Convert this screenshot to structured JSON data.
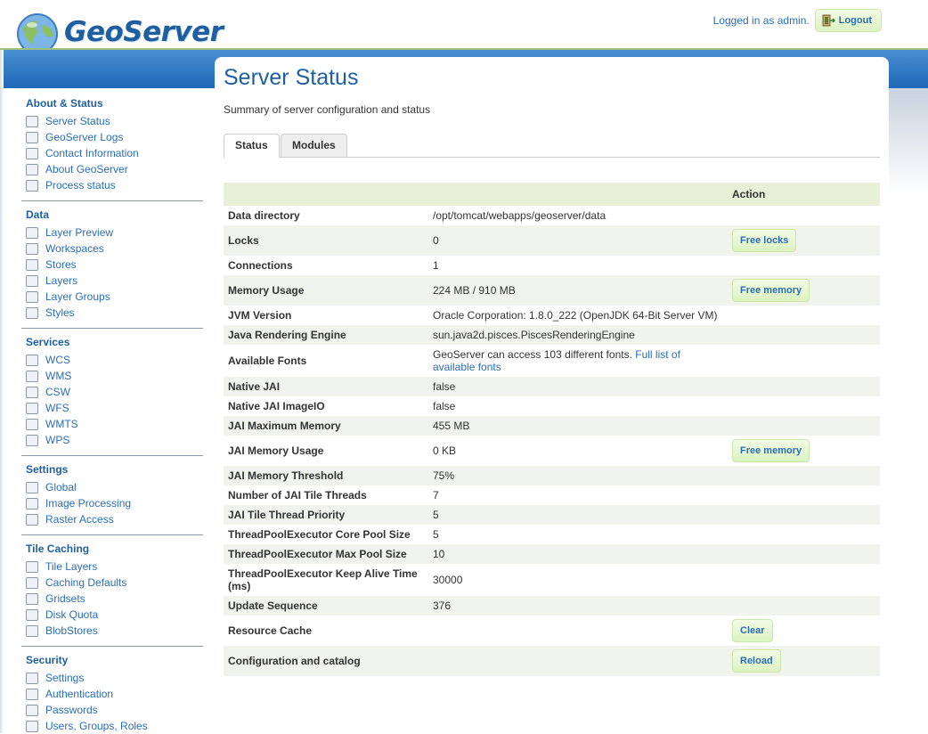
{
  "header": {
    "logo_text": "GeoServer",
    "login_status": "Logged in as admin.",
    "logout_label": "Logout"
  },
  "sidebar": {
    "sections": [
      {
        "title": "About & Status",
        "items": [
          {
            "label": "Server Status",
            "icon": "server-status-icon"
          },
          {
            "label": "GeoServer Logs",
            "icon": "logs-icon"
          },
          {
            "label": "Contact Information",
            "icon": "contact-icon"
          },
          {
            "label": "About GeoServer",
            "icon": "help-icon"
          },
          {
            "label": "Process status",
            "icon": "gear-icon"
          }
        ]
      },
      {
        "title": "Data",
        "items": [
          {
            "label": "Layer Preview",
            "icon": "layer-preview-icon"
          },
          {
            "label": "Workspaces",
            "icon": "folder-icon"
          },
          {
            "label": "Stores",
            "icon": "database-icon"
          },
          {
            "label": "Layers",
            "icon": "layers-icon"
          },
          {
            "label": "Layer Groups",
            "icon": "layer-groups-icon"
          },
          {
            "label": "Styles",
            "icon": "palette-icon"
          }
        ]
      },
      {
        "title": "Services",
        "items": [
          {
            "label": "WCS",
            "icon": "service-icon"
          },
          {
            "label": "WMS",
            "icon": "service-icon"
          },
          {
            "label": "CSW",
            "icon": "service-icon"
          },
          {
            "label": "WFS",
            "icon": "service-icon"
          },
          {
            "label": "WMTS",
            "icon": "service-icon"
          },
          {
            "label": "WPS",
            "icon": "service-icon"
          }
        ]
      },
      {
        "title": "Settings",
        "items": [
          {
            "label": "Global",
            "icon": "server-icon"
          },
          {
            "label": "Image Processing",
            "icon": "image-icon"
          },
          {
            "label": "Raster Access",
            "icon": "raster-icon"
          }
        ]
      },
      {
        "title": "Tile Caching",
        "items": [
          {
            "label": "Tile Layers",
            "icon": "grid-icon"
          },
          {
            "label": "Caching Defaults",
            "icon": "globe-icon"
          },
          {
            "label": "Gridsets",
            "icon": "grid-icon"
          },
          {
            "label": "Disk Quota",
            "icon": "disk-icon"
          },
          {
            "label": "BlobStores",
            "icon": "database-icon"
          }
        ]
      },
      {
        "title": "Security",
        "items": [
          {
            "label": "Settings",
            "icon": "wrench-icon"
          },
          {
            "label": "Authentication",
            "icon": "shield-icon"
          },
          {
            "label": "Passwords",
            "icon": "lock-icon"
          },
          {
            "label": "Users, Groups, Roles",
            "icon": "users-icon"
          }
        ]
      }
    ]
  },
  "main": {
    "title": "Server Status",
    "description": "Summary of server configuration and status",
    "tabs": [
      "Status",
      "Modules"
    ],
    "table": {
      "action_header": "Action",
      "rows": [
        {
          "name": "Data directory",
          "value": "/opt/tomcat/webapps/geoserver/data",
          "action": ""
        },
        {
          "name": "Locks",
          "value": "0",
          "action": "Free locks"
        },
        {
          "name": "Connections",
          "value": "1",
          "action": ""
        },
        {
          "name": "Memory Usage",
          "value": "224 MB / 910 MB",
          "action": "Free memory"
        },
        {
          "name": "JVM Version",
          "value": "Oracle Corporation: 1.8.0_222 (OpenJDK 64-Bit Server VM)",
          "action": ""
        },
        {
          "name": "Java Rendering Engine",
          "value": "sun.java2d.pisces.PiscesRenderingEngine",
          "action": ""
        },
        {
          "name": "Available Fonts",
          "value": "GeoServer can access 103 different fonts.",
          "link": "Full list of available fonts",
          "action": ""
        },
        {
          "name": "Native JAI",
          "value": "false",
          "action": ""
        },
        {
          "name": "Native JAI ImageIO",
          "value": "false",
          "action": ""
        },
        {
          "name": "JAI Maximum Memory",
          "value": "455 MB",
          "action": ""
        },
        {
          "name": "JAI Memory Usage",
          "value": "0 KB",
          "action": "Free memory"
        },
        {
          "name": "JAI Memory Threshold",
          "value": "75%",
          "action": ""
        },
        {
          "name": "Number of JAI Tile Threads",
          "value": "7",
          "action": ""
        },
        {
          "name": "JAI Tile Thread Priority",
          "value": "5",
          "action": ""
        },
        {
          "name": "ThreadPoolExecutor Core Pool Size",
          "value": "5",
          "action": ""
        },
        {
          "name": "ThreadPoolExecutor Max Pool Size",
          "value": "10",
          "action": ""
        },
        {
          "name": "ThreadPoolExecutor Keep Alive Time (ms)",
          "value": "30000",
          "action": ""
        },
        {
          "name": "Update Sequence",
          "value": "376",
          "action": ""
        },
        {
          "name": "Resource Cache",
          "value": "",
          "action": "Clear"
        },
        {
          "name": "Configuration and catalog",
          "value": "",
          "action": "Reload"
        }
      ]
    }
  }
}
